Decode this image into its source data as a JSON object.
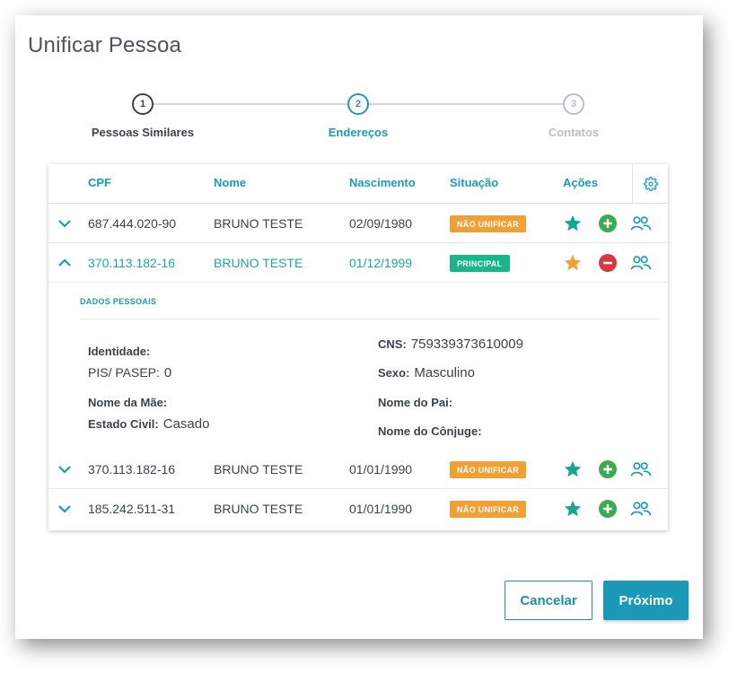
{
  "dialog": {
    "title": "Unificar Pessoa"
  },
  "stepper": {
    "steps": [
      {
        "number": "1",
        "label": "Pessoas Similares",
        "state": "done"
      },
      {
        "number": "2",
        "label": "Endereços",
        "state": "active"
      },
      {
        "number": "3",
        "label": "Contatos",
        "state": "future"
      }
    ]
  },
  "table": {
    "columns": {
      "cpf": "CPF",
      "nome": "Nome",
      "nascimento": "Nascimento",
      "situacao": "Situação",
      "acoes": "Ações"
    },
    "settings_icon": "gear-icon",
    "rows": [
      {
        "cpf": "687.444.020-90",
        "nome": "BRUNO TESTE",
        "nascimento": "02/09/1980",
        "situacao": "NÃO UNIFICAR",
        "situacao_color": "#f0a035",
        "expanded": false
      },
      {
        "cpf": "370.113.182-16",
        "nome": "BRUNO TESTE",
        "nascimento": "01/12/1999",
        "situacao": "PRINCIPAL",
        "situacao_color": "#19b58b",
        "expanded": true
      },
      {
        "cpf": "370.113.182-16",
        "nome": "BRUNO TESTE",
        "nascimento": "01/01/1990",
        "situacao": "NÃO UNIFICAR",
        "situacao_color": "#f0a035",
        "expanded": false
      },
      {
        "cpf": "185.242.511-31",
        "nome": "BRUNO TESTE",
        "nascimento": "01/01/1990",
        "situacao": "NÃO UNIFICAR",
        "situacao_color": "#f0a035",
        "expanded": false
      }
    ],
    "detail": {
      "title": "DADOS PESSOAIS",
      "identidade_label": "Identidade:",
      "identidade_value": "",
      "pis_label": "PIS/ PASEP:",
      "pis_value": "0",
      "mae_label": "Nome da Mãe:",
      "mae_value": "",
      "estado_civil_label": "Estado Civil:",
      "estado_civil_value": "Casado",
      "cns_label": "CNS:",
      "cns_value": "759339373610009",
      "sexo_label": "Sexo:",
      "sexo_value": "Masculino",
      "pai_label": "Nome do Pai:",
      "pai_value": "",
      "conjuge_label": "Nome do Cônjuge:",
      "conjuge_value": ""
    }
  },
  "footer": {
    "cancel_label": "Cancelar",
    "next_label": "Próximo"
  },
  "colors": {
    "accent": "#1b9ab8",
    "teal": "#1bab9b",
    "orange": "#f0a035",
    "green_action": "#3aab4f",
    "red_action": "#d9393d"
  }
}
